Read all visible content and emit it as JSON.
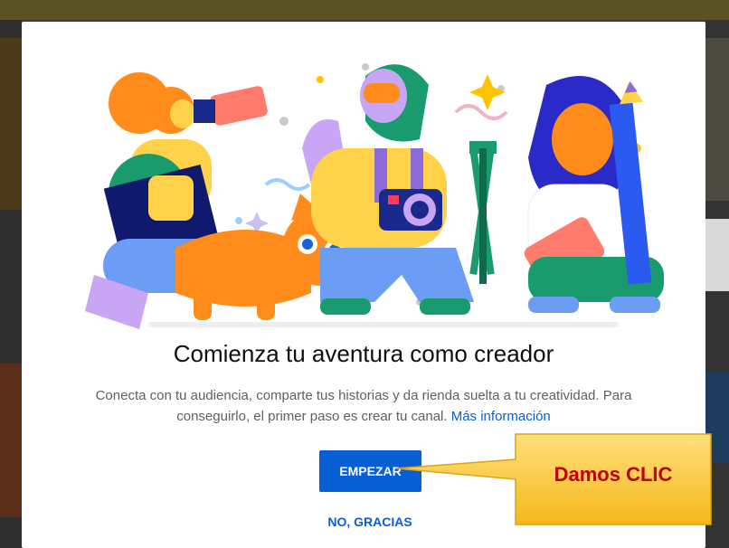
{
  "dialog": {
    "title": "Comienza tu aventura como creador",
    "description": "Conecta con tu audiencia, comparte tus historias y da rienda suelta a tu creatividad. Para conseguirlo, el primer paso es crear tu canal.",
    "more_info_link": "Más información",
    "start_button": "EMPEZAR",
    "decline_button": "NO, GRACIAS",
    "illustration_icon": "creators-illustration"
  },
  "annotation": {
    "callout_text": "Damos CLIC",
    "callout_color": "#ffd24a",
    "text_color": "#c00000"
  },
  "colors": {
    "accent": "#065fd4"
  }
}
